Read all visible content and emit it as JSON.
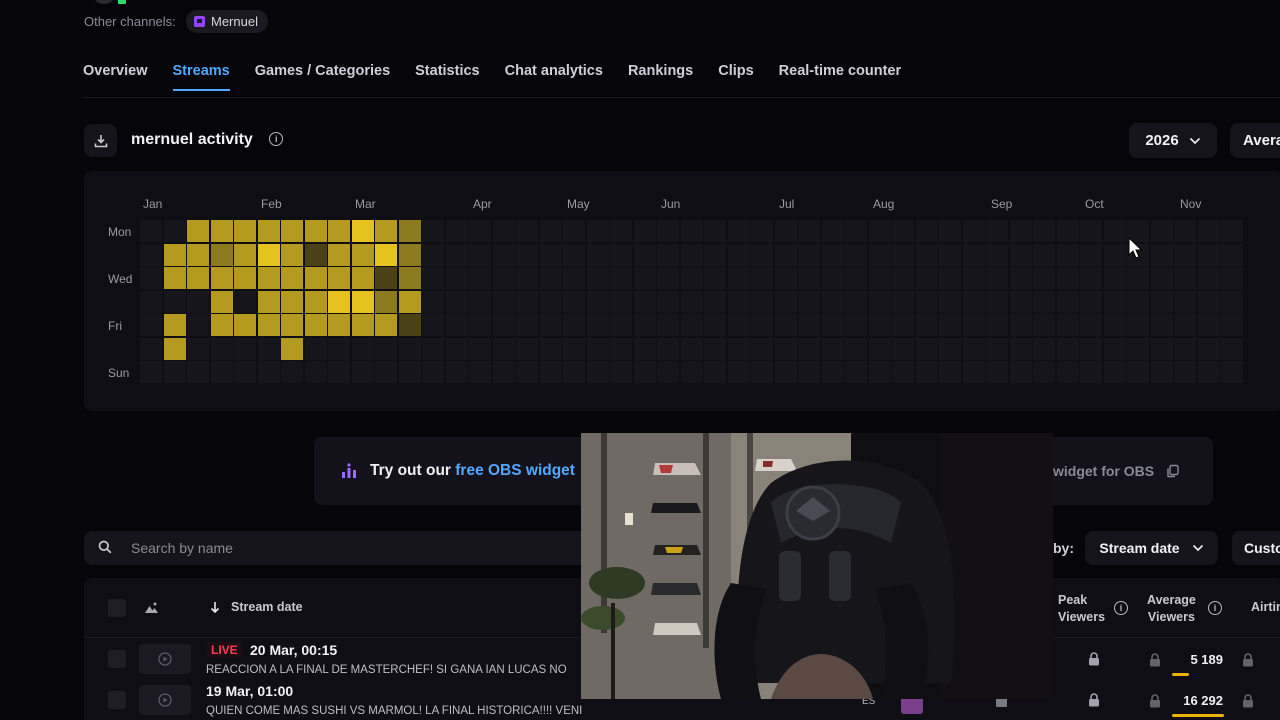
{
  "header": {
    "other_channels_label": "Other channels:",
    "channel_chip": "Mernuel"
  },
  "tabs": [
    "Overview",
    "Streams",
    "Games / Categories",
    "Statistics",
    "Chat analytics",
    "Rankings",
    "Clips",
    "Real-time counter"
  ],
  "active_tab": "Streams",
  "activity": {
    "title": "mernuel activity",
    "year": "2026",
    "mode_partial": "Avera",
    "months": [
      "Jan",
      "Feb",
      "Mar",
      "Apr",
      "May",
      "Jun",
      "Jul",
      "Aug",
      "Sep",
      "Oct",
      "Nov"
    ],
    "days": [
      "Mon",
      "Wed",
      "Fri",
      "Sun"
    ],
    "colors": {
      "empty": "#16151b",
      "level1": "#4a4216",
      "level2": "#8c7a1f",
      "level3": "#b59a20",
      "level4": "#e6c21f"
    },
    "weeks_shown": 47,
    "activity_levels": [
      [
        0,
        0,
        0,
        0,
        0,
        0,
        0
      ],
      [
        0,
        3,
        3,
        0,
        3,
        3,
        0
      ],
      [
        3,
        3,
        3,
        0,
        0,
        0,
        0
      ],
      [
        3,
        2,
        3,
        3,
        3,
        0,
        0
      ],
      [
        3,
        3,
        3,
        0,
        3,
        0,
        0
      ],
      [
        3,
        4,
        3,
        3,
        3,
        0,
        0
      ],
      [
        3,
        3,
        3,
        3,
        3,
        3,
        0
      ],
      [
        3,
        1,
        3,
        3,
        3,
        0,
        0
      ],
      [
        3,
        3,
        3,
        4,
        3,
        0,
        0
      ],
      [
        4,
        3,
        3,
        4,
        3,
        0,
        0
      ],
      [
        3,
        4,
        1,
        2,
        3,
        0,
        0
      ],
      [
        2,
        2,
        2,
        3,
        1,
        0,
        0
      ]
    ]
  },
  "banner": {
    "prefix": "Try out our ",
    "link": "free OBS widget",
    "right_text": "widget for OBS"
  },
  "filters": {
    "search_placeholder": "Search by name",
    "sort_label": "by:",
    "sort_value": "Stream date",
    "custom_partial": "Custo"
  },
  "table": {
    "headers": {
      "stream_date": "Stream date",
      "peak_viewers": [
        "Peak",
        "Viewers"
      ],
      "average_viewers": [
        "Average",
        "Viewers"
      ],
      "airtime_partial": "Airtin"
    },
    "rows": [
      {
        "live": "LIVE",
        "date": "20 Mar, 00:15",
        "title": "REACCION A LA FINAL DE MASTERCHEF! SI GANA IAN LUCAS NO",
        "avg_viewers": "5 189",
        "avg_fill": 0.32
      },
      {
        "date": "19 Mar, 01:00",
        "title": "QUIEN COME MAS SUSHI VS MARMOL! LA FINAL HISTORICA!!!! VENI",
        "lang": "ES",
        "avg_viewers": "16 292",
        "avg_fill": 1.0
      }
    ]
  },
  "webcam": {
    "chair_logo": "chair-logo"
  }
}
